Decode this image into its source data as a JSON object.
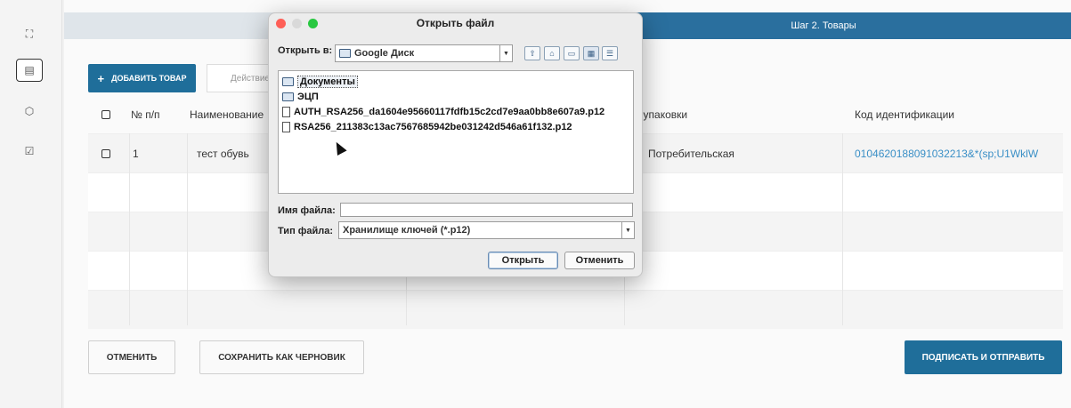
{
  "rail": {
    "items": [
      {
        "icon": "expand-icon",
        "glyph": "⛶"
      },
      {
        "icon": "document-icon",
        "glyph": "▤"
      },
      {
        "icon": "box-icon",
        "glyph": "⬡"
      },
      {
        "icon": "checklist-icon",
        "glyph": "☑"
      }
    ]
  },
  "stepper": {
    "step2": "Шаг 2. Товары"
  },
  "toolbar": {
    "add_label": "ДОБАВИТЬ ТОВАР",
    "add_glyph": "+",
    "action_placeholder": "Действие"
  },
  "table": {
    "headers": {
      "num": "№ п/п",
      "name": "Наименование",
      "pack": "ип упаковки",
      "code": "Код идентификации"
    },
    "rows": [
      {
        "num": "1",
        "name": "тест обувь",
        "pack": "Потребительская",
        "code": "0104620188091032213&*(sp;U1WklW"
      }
    ]
  },
  "buttons": {
    "cancel": "ОТМЕНИТЬ",
    "draft": "СОХРАНИТЬ КАК ЧЕРНОВИК",
    "sign": "ПОДПИСАТЬ И ОТПРАВИТЬ"
  },
  "dialog": {
    "title": "Открыть файл",
    "look_in_label": "Открыть в:",
    "look_in_value": "Google Диск",
    "files": [
      {
        "name": "Документы",
        "type": "folder",
        "selected": true
      },
      {
        "name": "ЭЦП",
        "type": "folder",
        "selected": false
      },
      {
        "name": "AUTH_RSA256_da1604e95660117fdfb15c2cd7e9aa0bb8e607a9.p12",
        "type": "file",
        "selected": false
      },
      {
        "name": "RSA256_211383c13ac7567685942be031242d546a61f132.p12",
        "type": "file",
        "selected": false
      }
    ],
    "file_name_label": "Имя файла:",
    "file_name_value": "",
    "file_type_label": "Тип файла:",
    "file_type_value": "Хранилище ключей (*.p12)",
    "open_button": "Открыть",
    "cancel_button": "Отменить"
  },
  "colors": {
    "accent": "#1f6e9a",
    "link": "#3a8fc6",
    "close": "#fe5f57",
    "minimize": "#d9d9d9",
    "zoom": "#28c840"
  }
}
